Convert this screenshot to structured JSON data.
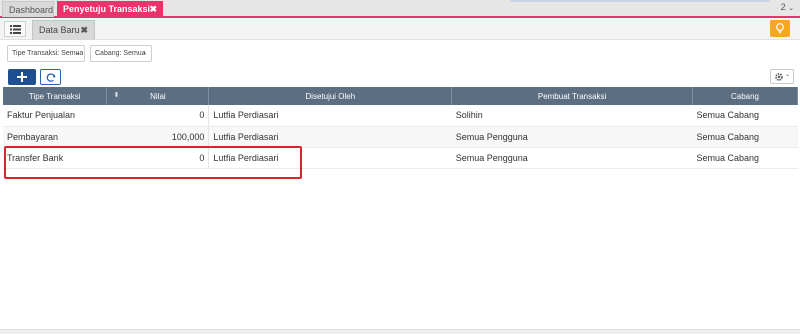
{
  "top_tabs": {
    "dashboard": "Dashboard",
    "active": "Penyetuju Transaksi",
    "close_symbol": "✖"
  },
  "top_right": {
    "value": "2"
  },
  "sub_tab": {
    "label": "Data Baru",
    "close_symbol": "✖"
  },
  "filters": {
    "tipe": "Tipe Transaksi: Semua",
    "cabang": "Cabang: Semua"
  },
  "table": {
    "headers": [
      "Tipe Transaksi",
      "Nilai",
      "Disetujui Oleh",
      "Pembuat Transaksi",
      "Cabang"
    ],
    "rows": [
      [
        "Faktur Penjualan",
        "0",
        "Lutfia Perdiasari",
        "Solihin",
        "Semua Cabang"
      ],
      [
        "Pembayaran",
        "100,000",
        "Lutfia Perdiasari",
        "Semua Pengguna",
        "Semua Cabang"
      ],
      [
        "Transfer Bank",
        "0",
        "Lutfia Perdiasari",
        "Semua Pengguna",
        "Semua Cabang"
      ]
    ]
  },
  "icons": {
    "list": "list-icon",
    "add": "plus-icon",
    "refresh": "refresh-icon",
    "settings": "gear-icon",
    "tip": "lightbulb-icon"
  },
  "colors": {
    "accent": "#e8336b",
    "header": "#5b6e82",
    "primary": "#1e4f91",
    "warning": "#f5a623",
    "highlight": "#d9262c"
  }
}
